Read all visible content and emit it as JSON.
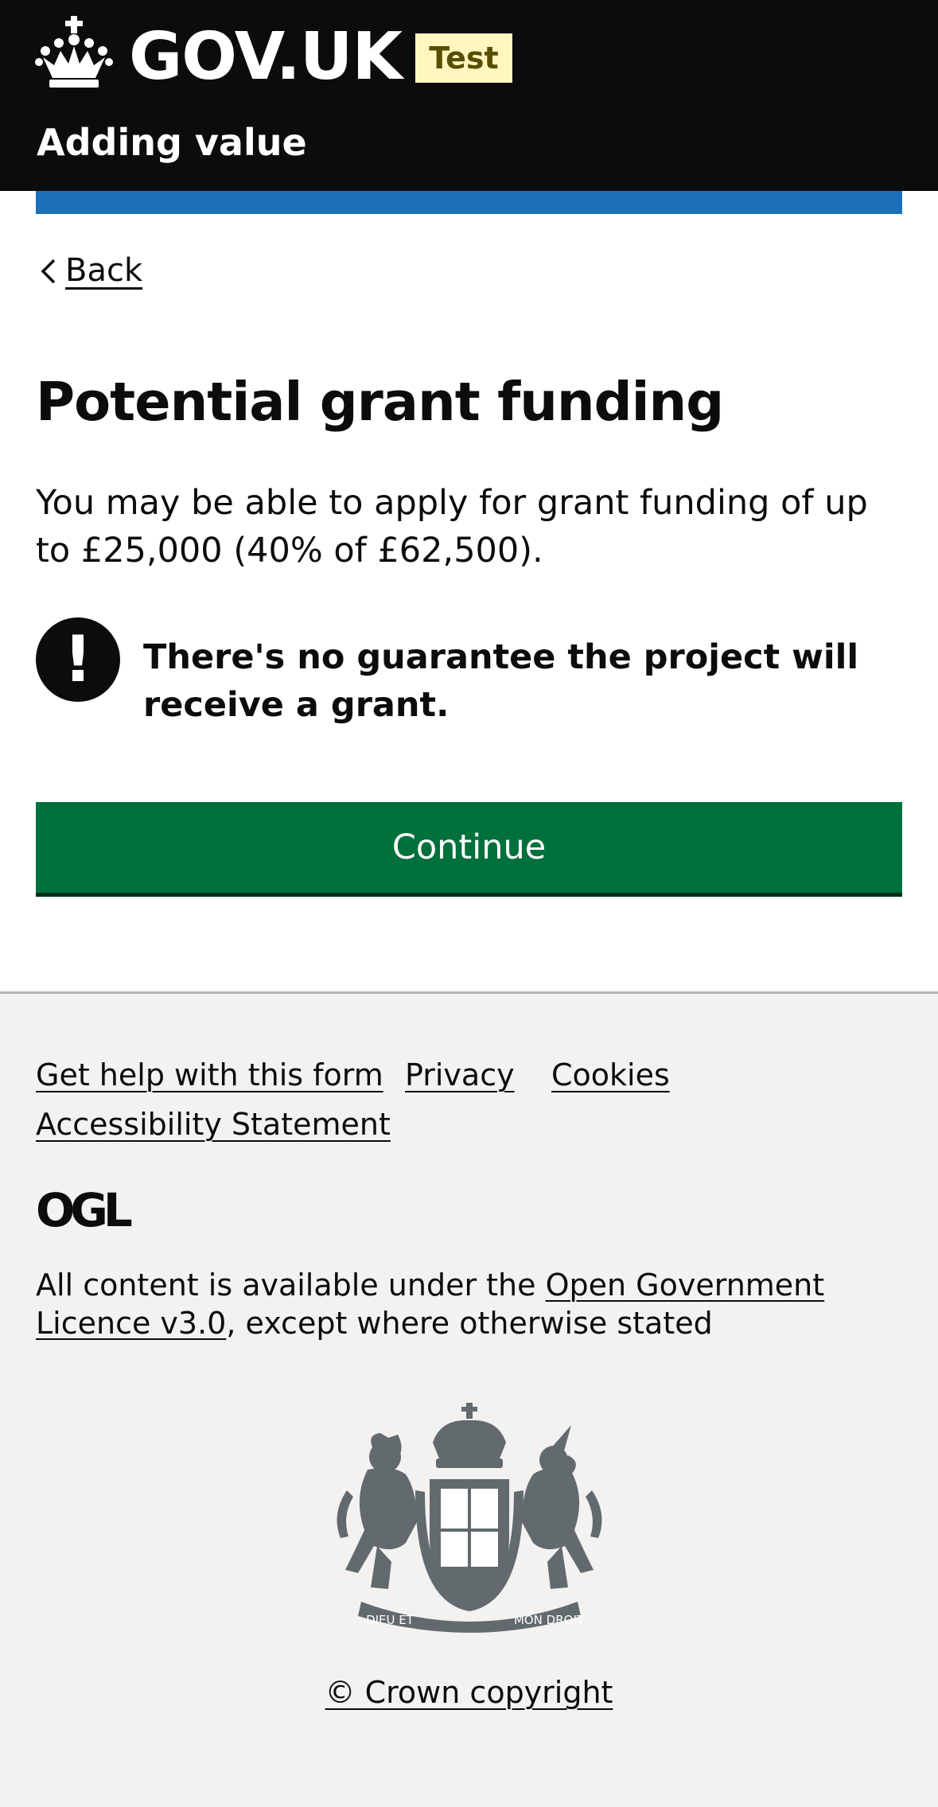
{
  "header": {
    "logo_text": "GOV.UK",
    "phase_tag": "Test",
    "service_name": "Adding value"
  },
  "back_link": {
    "label": "Back"
  },
  "main": {
    "title": "Potential grant funding",
    "body": "You may be able to apply for grant funding of up to £25,000 (40% of £62,500).",
    "warning": {
      "icon": "!",
      "text": "There's no guarantee the project will receive a grant."
    },
    "continue_label": "Continue"
  },
  "footer": {
    "links": [
      "Get help with this form",
      "Privacy",
      "Cookies",
      "Accessibility Statement"
    ],
    "ogl_logo_text": "OGL",
    "licence": {
      "prefix": "All content is available under the ",
      "link": "Open Government Licence v3.0",
      "suffix": ", except where otherwise stated"
    },
    "crest_mottos": [
      "DIEU ET",
      "MON DROIT"
    ],
    "copyright": "© Crown copyright"
  },
  "colors": {
    "header_bg": "#0b0c0c",
    "accent_blue": "#1d70b8",
    "button_green": "#00703c",
    "tag_bg": "#fff7bf",
    "tag_text": "#594d00",
    "footer_bg": "#f3f2f1",
    "crest_grey": "#626a6e"
  },
  "icons": {
    "logo": "crown-icon",
    "back": "chevron-left-icon",
    "warning": "exclamation-icon",
    "licence_logo": "ogl-logo",
    "crest": "royal-coat-of-arms"
  }
}
